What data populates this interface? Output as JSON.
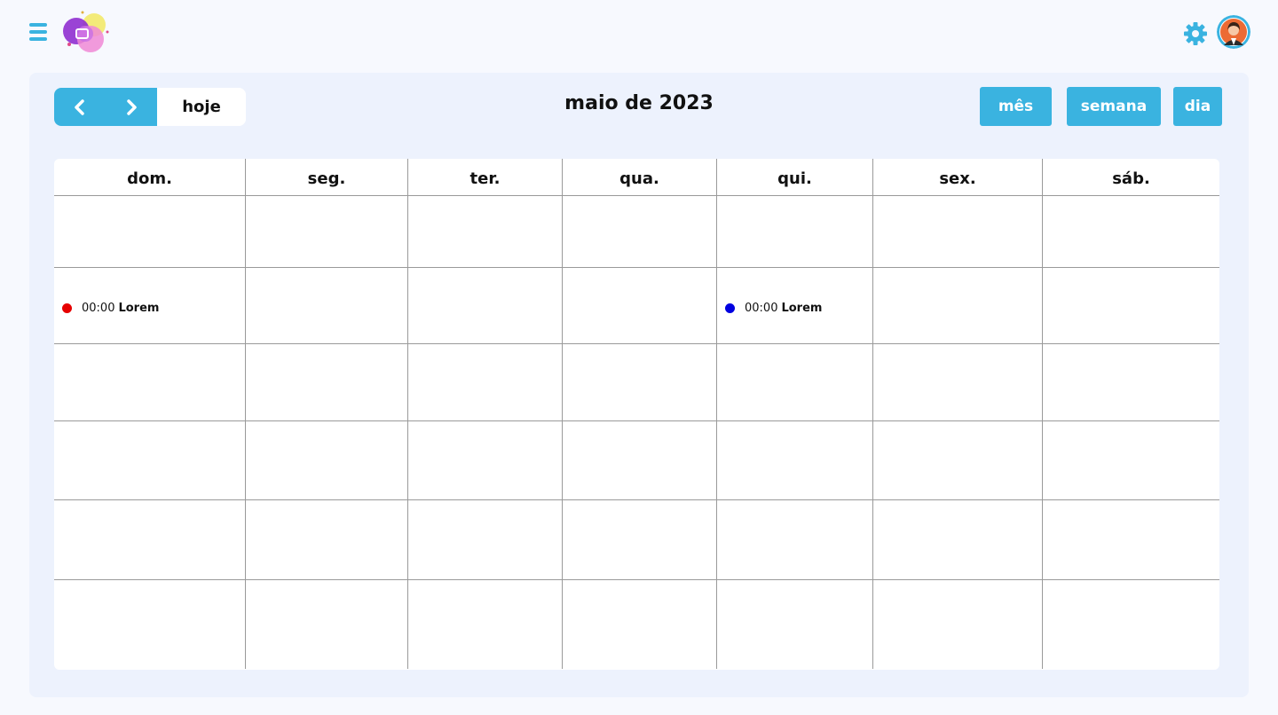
{
  "header": {
    "menu_icon": "hamburger-menu-icon",
    "logo_icon": "colorful-bubble-logo",
    "settings_icon": "gear-icon",
    "avatar_icon": "user-avatar"
  },
  "toolbar": {
    "prev_icon": "chevron-left-icon",
    "next_icon": "chevron-right-icon",
    "today_label": "hoje",
    "title": "maio de 2023",
    "view_month_label": "mês",
    "view_week_label": "semana",
    "view_day_label": "dia"
  },
  "calendar": {
    "weekdays": [
      "dom.",
      "seg.",
      "ter.",
      "qua.",
      "qui.",
      "sex.",
      "sáb."
    ],
    "events": [
      {
        "row": 1,
        "col": 0,
        "time": "00:00",
        "title": "Lorem",
        "color": "#e60000"
      },
      {
        "row": 1,
        "col": 4,
        "time": "00:00",
        "title": "Lorem",
        "color": "#0000e0"
      }
    ]
  },
  "colors": {
    "accent": "#3ab3e0",
    "panel": "#edf2fd",
    "background": "#f7f9fe",
    "event_red": "#e60000",
    "event_blue": "#0000e0"
  }
}
